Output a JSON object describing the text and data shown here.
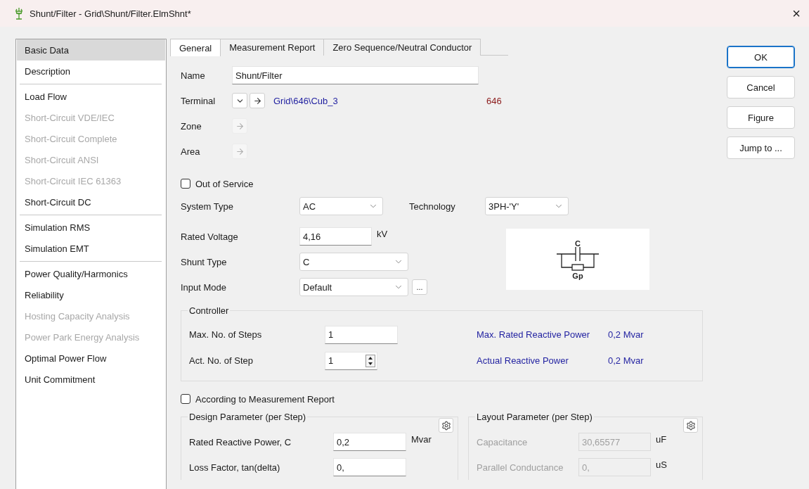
{
  "window": {
    "title": "Shunt/Filter - Grid\\Shunt/Filter.ElmShnt*",
    "close": "×"
  },
  "sidebar": {
    "groups": [
      {
        "items": [
          {
            "label": "Basic Data",
            "selected": true,
            "disabled": false
          },
          {
            "label": "Description",
            "selected": false,
            "disabled": false
          }
        ]
      },
      {
        "items": [
          {
            "label": "Load Flow",
            "selected": false,
            "disabled": false
          },
          {
            "label": "Short-Circuit VDE/IEC",
            "selected": false,
            "disabled": true
          },
          {
            "label": "Short-Circuit Complete",
            "selected": false,
            "disabled": true
          },
          {
            "label": "Short-Circuit ANSI",
            "selected": false,
            "disabled": true
          },
          {
            "label": "Short-Circuit IEC 61363",
            "selected": false,
            "disabled": true
          },
          {
            "label": "Short-Circuit DC",
            "selected": false,
            "disabled": false
          }
        ]
      },
      {
        "items": [
          {
            "label": "Simulation RMS",
            "selected": false,
            "disabled": false
          },
          {
            "label": "Simulation EMT",
            "selected": false,
            "disabled": false
          }
        ]
      },
      {
        "items": [
          {
            "label": "Power Quality/Harmonics",
            "selected": false,
            "disabled": false
          },
          {
            "label": "Reliability",
            "selected": false,
            "disabled": false
          },
          {
            "label": "Hosting Capacity Analysis",
            "selected": false,
            "disabled": true
          },
          {
            "label": "Power Park Energy Analysis",
            "selected": false,
            "disabled": true
          },
          {
            "label": "Optimal Power Flow",
            "selected": false,
            "disabled": false
          },
          {
            "label": "Unit Commitment",
            "selected": false,
            "disabled": false
          }
        ]
      }
    ]
  },
  "tabs": [
    {
      "label": "General",
      "selected": true
    },
    {
      "label": "Measurement Report",
      "selected": false
    },
    {
      "label": "Zero Sequence/Neutral Conductor",
      "selected": false
    }
  ],
  "name": {
    "label": "Name",
    "value": "Shunt/Filter"
  },
  "terminal": {
    "label": "Terminal",
    "link": "Grid\\646\\Cub_3",
    "node": "646"
  },
  "zone": {
    "label": "Zone",
    "disabled": true
  },
  "area": {
    "label": "Area",
    "disabled": true
  },
  "out_of_service": {
    "label": "Out of Service",
    "checked": false
  },
  "system_type": {
    "label": "System Type",
    "value": "AC"
  },
  "technology": {
    "label": "Technology",
    "value": "3PH-'Y'"
  },
  "rated_voltage": {
    "label": "Rated Voltage",
    "value": "4,16",
    "unit": "kV"
  },
  "shunt_type": {
    "label": "Shunt Type",
    "value": "C"
  },
  "input_mode": {
    "label": "Input Mode",
    "value": "Default",
    "more": "..."
  },
  "diagram": {
    "top_label": "C",
    "bottom_label": "Gp"
  },
  "controller": {
    "title": "Controller",
    "fields": [
      {
        "label": "Max. No. of Steps",
        "value": "1",
        "kind": "input"
      },
      {
        "label": "Act. No. of Step",
        "value": "1",
        "kind": "spinner"
      }
    ],
    "readouts": [
      {
        "label": "Max. Rated Reactive Power",
        "value": "0,2 Mvar"
      },
      {
        "label": "Actual Reactive Power",
        "value": "0,2 Mvar"
      }
    ]
  },
  "measurement_report": {
    "label": "According to Measurement Report",
    "checked": false
  },
  "design": {
    "title": "Design Parameter (per Step)",
    "fields": [
      {
        "label": "Rated Reactive Power, C",
        "value": "0,2",
        "unit": "Mvar",
        "disabled": false
      },
      {
        "label": "Loss Factor, tan(delta)",
        "value": "0,",
        "disabled": false
      }
    ]
  },
  "layout": {
    "title": "Layout Parameter (per Step)",
    "fields": [
      {
        "label": "Capacitance",
        "value": "30,65577",
        "unit": "uF",
        "disabled": true
      },
      {
        "label": "Parallel Conductance",
        "value": "0,",
        "unit": "uS",
        "disabled": true
      }
    ]
  },
  "buttons": [
    {
      "label": "OK",
      "default": true
    },
    {
      "label": "Cancel",
      "default": false
    },
    {
      "label": "Figure",
      "default": false
    },
    {
      "label": "Jump to ...",
      "default": false
    }
  ]
}
